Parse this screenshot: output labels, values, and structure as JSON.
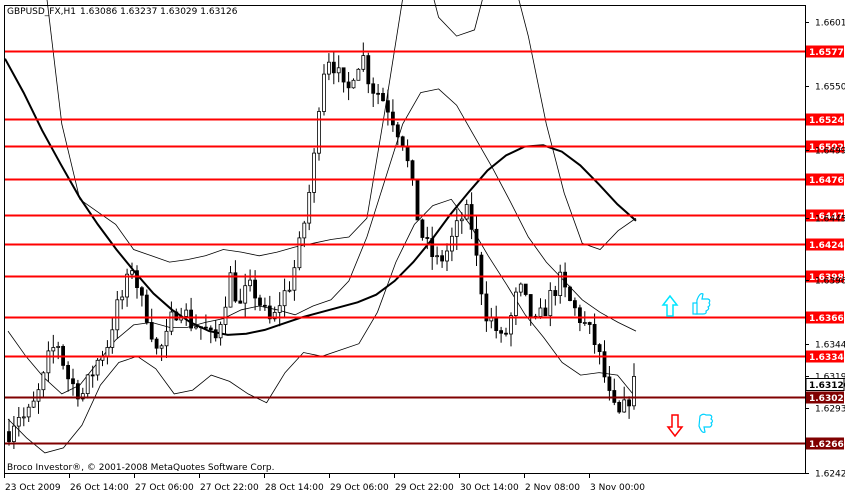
{
  "header": {
    "symbol_tf": "GBPUSD_FX,H1",
    "ohlc": "1.63086 1.63237 1.63029 1.63126"
  },
  "copyright": "Broco Investor®, © 2001-2008 MetaQuotes Software Corp.",
  "colors": {
    "level_line": "#ff0000",
    "level_line_dark": "#800000",
    "candle": "#000000",
    "up_arrow": "#00e5ff",
    "down_arrow": "#ff0000",
    "thumb": "#00d2ff"
  },
  "chart_data": {
    "type": "candlestick",
    "ylim": [
      1.6242,
      1.6614
    ],
    "price_ticks": [
      "1.66010",
      "1.65500",
      "1.64990",
      "1.64450",
      "1.63960",
      "1.63445",
      "1.63190",
      "1.62935",
      "1.62420"
    ],
    "time_labels": [
      "23 Oct 2009",
      "26 Oct 14:00",
      "27 Oct 06:00",
      "27 Oct 22:00",
      "28 Oct 14:00",
      "29 Oct 06:00",
      "29 Oct 22:00",
      "30 Oct 14:00",
      "2 Nov 08:00",
      "3 Nov 00:00"
    ],
    "levels": [
      {
        "label": "1.65779",
        "value": 1.65779,
        "style": "red"
      },
      {
        "label": "1.65242",
        "value": 1.65242,
        "style": "red"
      },
      {
        "label": "1.65021",
        "value": 1.65021,
        "style": "red"
      },
      {
        "label": "1.64760",
        "value": 1.6476,
        "style": "red"
      },
      {
        "label": "1.64479",
        "value": 1.64479,
        "style": "red"
      },
      {
        "label": "1.64248",
        "value": 1.64248,
        "style": "red"
      },
      {
        "label": "1.63986",
        "value": 1.63986,
        "style": "red"
      },
      {
        "label": "1.63663",
        "value": 1.63663,
        "style": "red"
      },
      {
        "label": "1.63349",
        "value": 1.63349,
        "style": "red"
      },
      {
        "label": "1.63023",
        "value": 1.63023,
        "style": "dark"
      },
      {
        "label": "1.62661",
        "value": 1.62661,
        "style": "dark"
      }
    ],
    "current": {
      "label": "1.63126",
      "value": 1.63126
    },
    "path": [
      1.6275,
      1.629,
      1.6285,
      1.6296,
      1.6312,
      1.6338,
      1.6345,
      1.632,
      1.631,
      1.6305,
      1.632,
      1.6335,
      1.6345,
      1.6372,
      1.6385,
      1.6408,
      1.638,
      1.6365,
      1.6338,
      1.6345,
      1.637,
      1.6375,
      1.6362,
      1.636,
      1.6355,
      1.6345,
      1.6372,
      1.64,
      1.6372,
      1.639,
      1.6385,
      1.637,
      1.636,
      1.638,
      1.639,
      1.6412,
      1.6445,
      1.6485,
      1.656,
      1.6575,
      1.656,
      1.654,
      1.6565,
      1.6575,
      1.655,
      1.6545,
      1.6535,
      1.652,
      1.6505,
      1.647,
      1.6435,
      1.642,
      1.641,
      1.6415,
      1.643,
      1.6445,
      1.645,
      1.6405,
      1.637,
      1.636,
      1.6345,
      1.6365,
      1.639,
      1.6375,
      1.636,
      1.637,
      1.6385,
      1.6395,
      1.638,
      1.637,
      1.636,
      1.635,
      1.633,
      1.6302,
      1.6285,
      1.6295,
      1.6313
    ],
    "ma_slow": [
      1.6572,
      1.6545,
      1.6515,
      1.6488,
      1.6462,
      1.644,
      1.642,
      1.6402,
      1.6385,
      1.6372,
      1.6362,
      1.6355,
      1.6352,
      1.6353,
      1.6356,
      1.6361,
      1.6366,
      1.637,
      1.6374,
      1.6378,
      1.6384,
      1.6395,
      1.641,
      1.6428,
      1.6448,
      1.6466,
      1.6483,
      1.6495,
      1.6502,
      1.6503,
      1.6498,
      1.6487,
      1.6472,
      1.6456,
      1.6443
    ],
    "bb_upper": [
      1.668,
      1.672,
      1.664,
      1.652,
      1.646,
      1.645,
      1.644,
      1.642,
      1.6415,
      1.641,
      1.6412,
      1.6415,
      1.642,
      1.6418,
      1.6415,
      1.6418,
      1.6422,
      1.6425,
      1.6428,
      1.643,
      1.6445,
      1.653,
      1.662,
      1.666,
      1.6605,
      1.659,
      1.6595,
      1.665,
      1.6645,
      1.659,
      1.652,
      1.6465,
      1.6425,
      1.642,
      1.6435,
      1.6445
    ],
    "bb_mid": [
      1.6355,
      1.6335,
      1.6318,
      1.6305,
      1.6312,
      1.633,
      1.6348,
      1.636,
      1.6362,
      1.6358,
      1.6358,
      1.6362,
      1.6365,
      1.6372,
      1.6375,
      1.6372,
      1.6368,
      1.6375,
      1.638,
      1.6395,
      1.643,
      1.6475,
      1.652,
      1.6545,
      1.6548,
      1.6535,
      1.651,
      1.6485,
      1.6458,
      1.643,
      1.641,
      1.6395,
      1.638,
      1.637,
      1.6362,
      1.6355
    ],
    "bb_lower": [
      1.6285,
      1.627,
      1.6258,
      1.6262,
      1.628,
      1.6312,
      1.633,
      1.6335,
      1.6325,
      1.6305,
      1.6308,
      1.632,
      1.6315,
      1.6305,
      1.6298,
      1.6322,
      1.6338,
      1.6335,
      1.634,
      1.6345,
      1.637,
      1.641,
      1.644,
      1.6455,
      1.646,
      1.644,
      1.6415,
      1.6392,
      1.6368,
      1.635,
      1.633,
      1.632,
      1.6322,
      1.632,
      1.6302
    ]
  }
}
